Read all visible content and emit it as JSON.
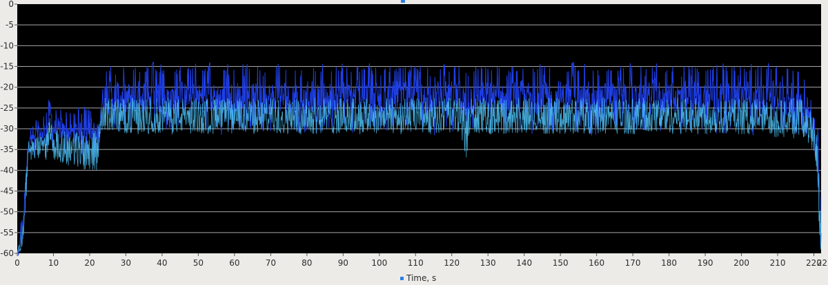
{
  "chart_data": {
    "type": "line",
    "title": "",
    "xlabel": "Time, s",
    "ylabel": "",
    "xlim": [
      0,
      222
    ],
    "ylim": [
      -60,
      0
    ],
    "grid": true,
    "x_ticks": [
      0,
      10,
      20,
      30,
      40,
      50,
      60,
      70,
      80,
      90,
      100,
      110,
      120,
      130,
      140,
      150,
      160,
      170,
      180,
      190,
      200,
      210,
      220
    ],
    "x_tick_labels": [
      "0",
      "10",
      "20",
      "30",
      "40",
      "50",
      "60",
      "70",
      "80",
      "90",
      "100",
      "110",
      "120",
      "130",
      "140",
      "150",
      "160",
      "170",
      "180",
      "190",
      "200",
      "210",
      "220"
    ],
    "x_edge_label": "22",
    "y_ticks": [
      0,
      -5,
      -10,
      -15,
      -20,
      -25,
      -30,
      -35,
      -40,
      -45,
      -50,
      -55,
      -60
    ],
    "y_tick_labels": [
      "0",
      "-5",
      "-10",
      "-15",
      "-20",
      "-25",
      "-30",
      "-35",
      "-40",
      "-45",
      "-50",
      "-55",
      "-60"
    ],
    "colors": {
      "plot_background": "#000000",
      "gridline": "#a8a8a8",
      "frame_background": "#ecebe8",
      "marker": "#2f7fe0"
    },
    "series": [
      {
        "color": "#1f3fe8",
        "envelope": {
          "x": [
            0,
            1,
            2,
            3,
            8,
            9,
            10,
            15,
            21,
            22,
            23,
            24,
            30,
            60,
            90,
            110,
            122,
            123.5,
            124,
            125,
            150,
            180,
            200,
            210,
            215,
            217,
            218,
            220,
            221,
            221.5,
            222
          ],
          "high": [
            -60,
            -52,
            -40,
            -30,
            -25,
            -20,
            -24,
            -25,
            -24,
            -25,
            -20,
            -14,
            -14,
            -14,
            -14,
            -14,
            -14,
            -14,
            -14,
            -14,
            -14,
            -14,
            -14,
            -14,
            -14,
            -14,
            -20,
            -23,
            -27,
            -40,
            -48
          ],
          "low": [
            -60,
            -60,
            -55,
            -37,
            -37,
            -31,
            -36,
            -37,
            -38,
            -40,
            -30,
            -30,
            -31,
            -31,
            -31,
            -31,
            -31,
            -34,
            -42,
            -31,
            -31,
            -31,
            -31,
            -31,
            -32,
            -32,
            -32,
            -34,
            -40,
            -58,
            -60
          ]
        }
      },
      {
        "color": "#4fc3f7",
        "envelope": {
          "x": [
            0,
            1,
            2,
            3,
            8,
            9,
            10,
            15,
            21,
            22,
            23,
            24,
            30,
            60,
            90,
            110,
            122,
            123.5,
            124,
            125,
            150,
            180,
            200,
            210,
            215,
            217,
            218,
            220,
            221,
            221.5,
            222
          ],
          "high": [
            -60,
            -55,
            -44,
            -32,
            -30,
            -26,
            -29,
            -29,
            -28,
            -29,
            -25,
            -21,
            -21,
            -21,
            -21,
            -21,
            -21,
            -21,
            -21,
            -21,
            -21,
            -21,
            -21,
            -21,
            -21,
            -21,
            -23,
            -25,
            -29,
            -42,
            -50
          ],
          "low": [
            -60,
            -60,
            -57,
            -38,
            -38,
            -33,
            -38,
            -40,
            -41,
            -42,
            -31,
            -31,
            -32,
            -32,
            -32,
            -32,
            -32,
            -35,
            -42,
            -32,
            -32,
            -32,
            -32,
            -33,
            -33,
            -33,
            -34,
            -36,
            -42,
            -59,
            -60
          ]
        }
      }
    ]
  }
}
